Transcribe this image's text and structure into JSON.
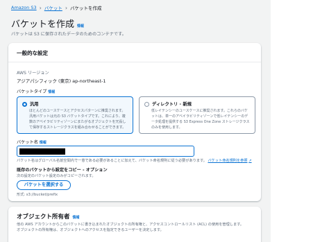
{
  "breadcrumb": {
    "items": [
      "Amazon S3",
      "バケット",
      "バケットを作成"
    ]
  },
  "page": {
    "title": "バケットを作成",
    "info_link": "情報",
    "subtitle": "バケットは S3 に保存されたデータのためのコンテナです。"
  },
  "general": {
    "header": "一般的な設定",
    "region_label": "AWS リージョン",
    "region_value": "アジアパシフィック (東京) ap-northeast-1",
    "bucket_type_label": "バケットタイプ",
    "bucket_type_info": "情報",
    "options": [
      {
        "title": "汎用",
        "desc": "ほとんどのユースケースとアクセスパターンに推奨されます。汎用バケットは元の S3 バケットタイプです。これにより、複数のアベイラビリティゾーンにまたがるオブジェクトを冗長して保存するストレージクラスを組み合わせることができます。",
        "selected": true
      },
      {
        "title": "ディレクトリ - 新規",
        "desc": "低レイテンシーのユースケースに推奨されます。これらのバケットは、単一のアベイラビリティゾーンで低レイテンシーのデータ処理を提供する S3 Express One Zone ストレージクラスのみを使用します。",
        "selected": false
      }
    ],
    "bucket_name_label": "バケット名",
    "bucket_name_info": "情報",
    "bucket_name_help": "バケット名はグローバル名前空間内で一意である必要があることに加えて、バケット命名規則に従う必要があります。",
    "bucket_name_rules_link": "バケット命名規則を参照",
    "copy_label": "既存のバケットから設定をコピー - オプション",
    "copy_desc": "次の設定のバケット設定のみがコピーされます。",
    "choose_bucket_button": "バケットを選択する",
    "format_hint": "形式: s3://bucket/prefix"
  },
  "ownership": {
    "title": "オブジェクト所有者",
    "info": "情報",
    "desc_line1": "他の AWS アカウントからこのバケットに書き込まれたオブジェクトの所有権と、アクセスコントロールリスト (ACL) の使用を管理します。",
    "desc_line2": "オブジェクトの所有権は、オブジェクトへのアクセスを指定できるユーザーを決定します。"
  },
  "colors": {
    "accent": "#0972d3",
    "text": "#16191f",
    "muted": "#5f6b7a",
    "background": "#f2f3f3"
  }
}
